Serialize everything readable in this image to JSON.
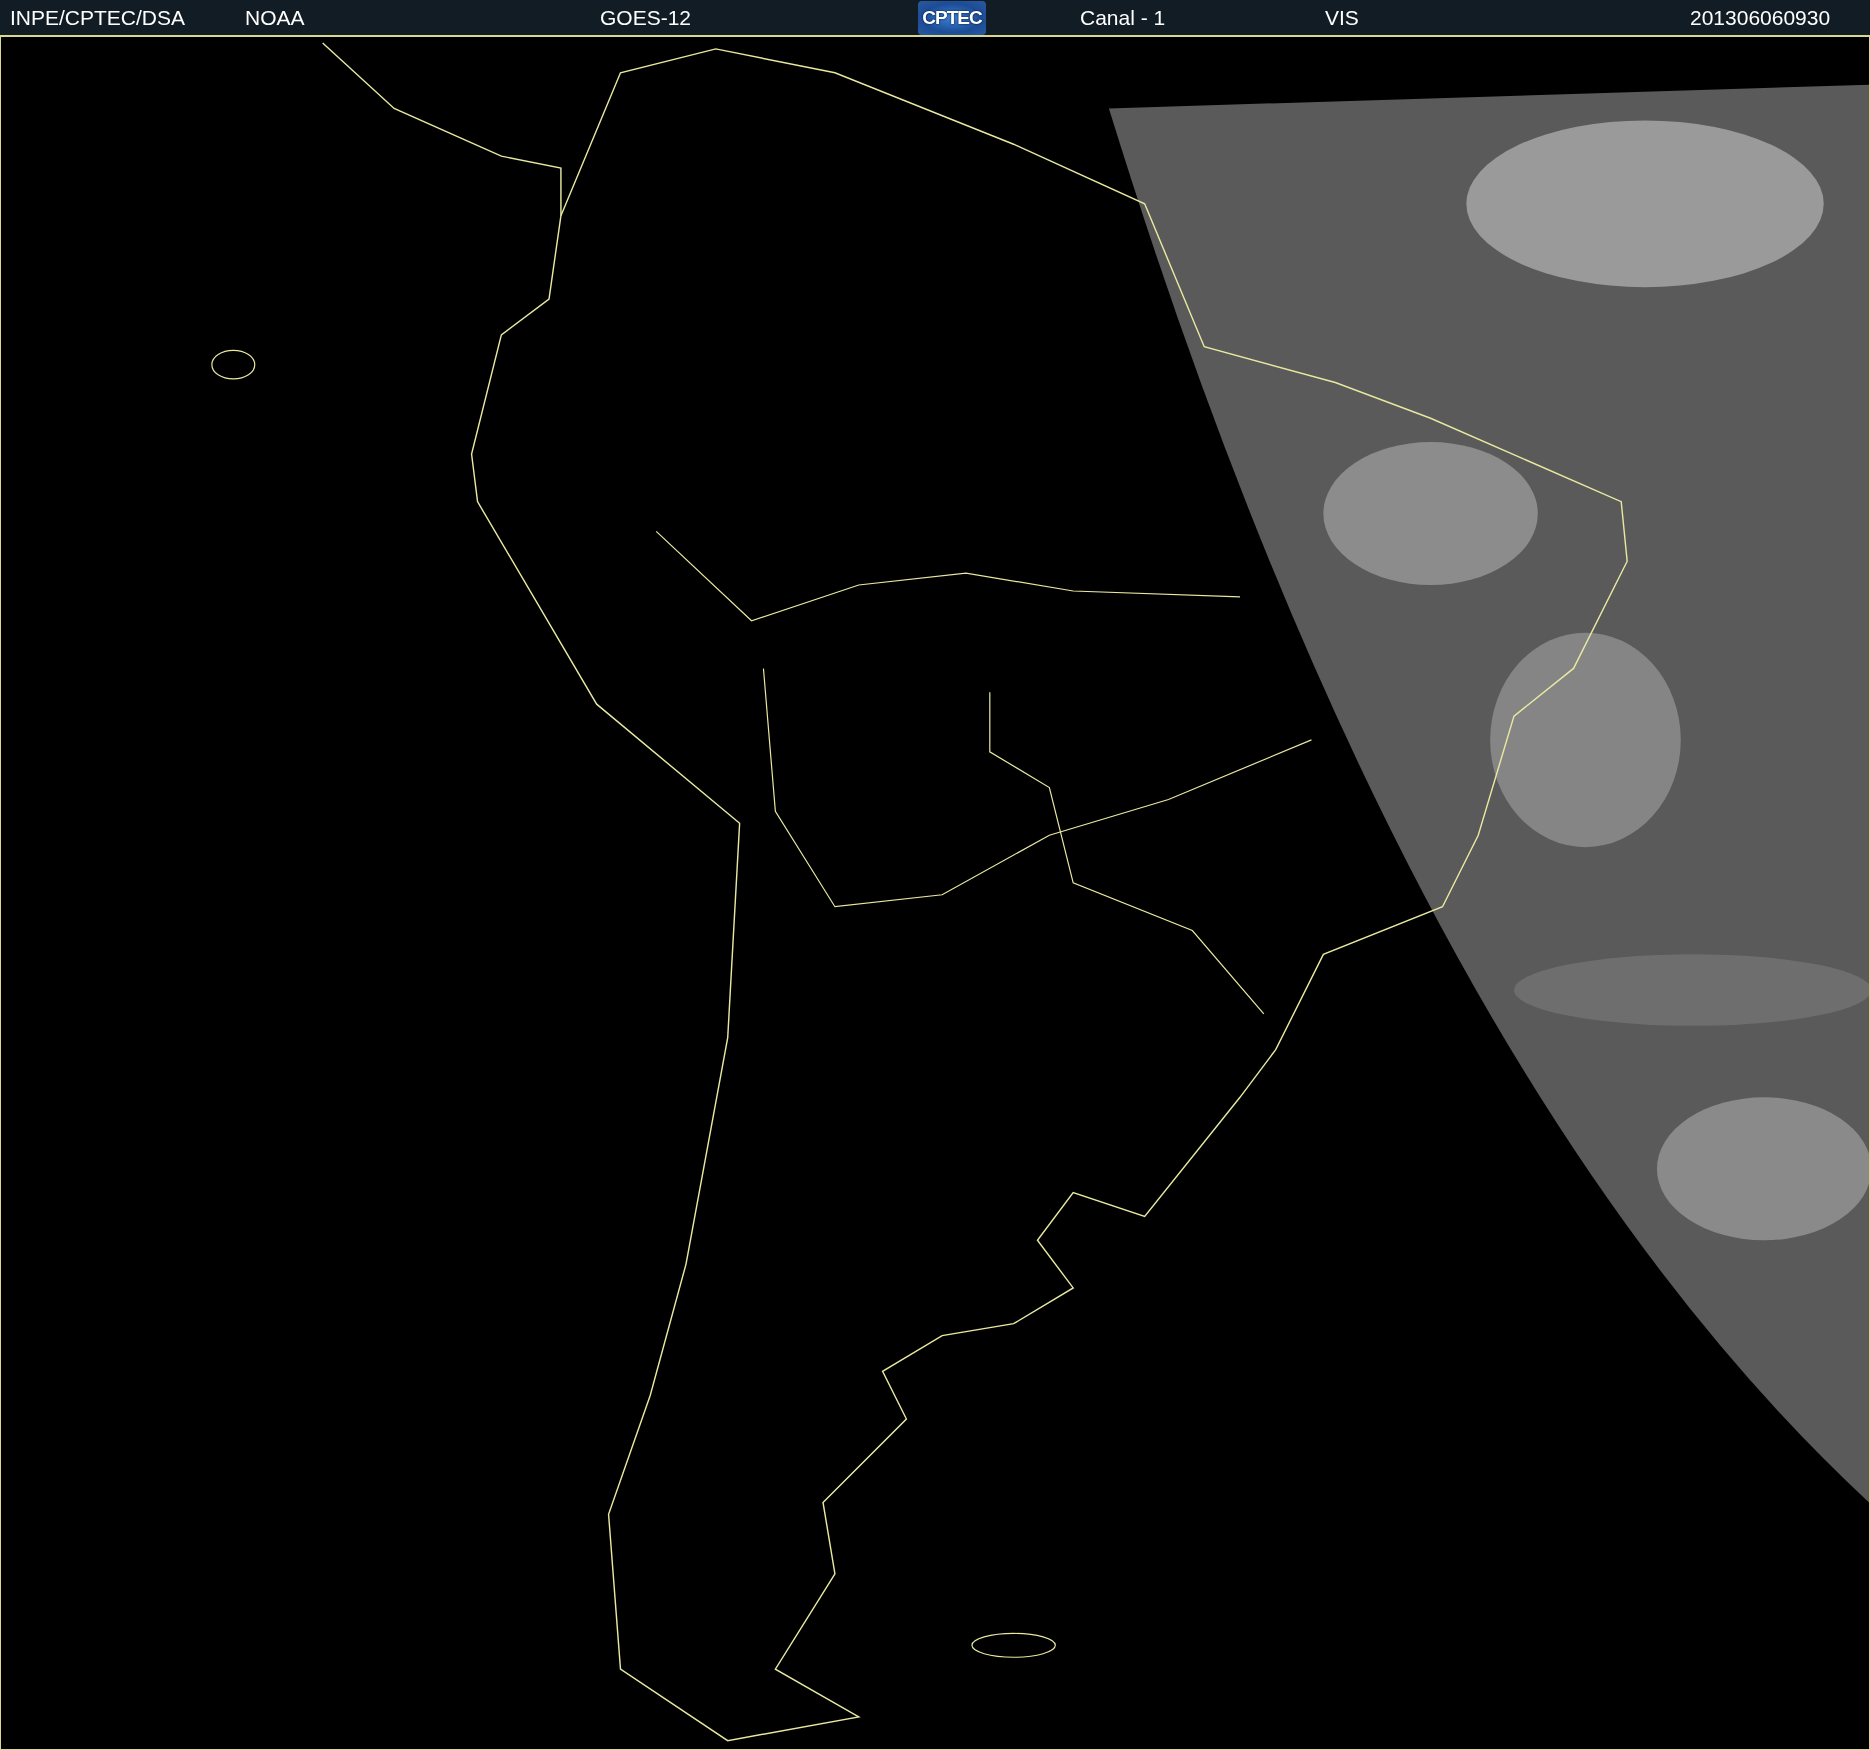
{
  "header": {
    "items": [
      {
        "kind": "text",
        "text": "INPE/CPTEC/DSA"
      },
      {
        "kind": "text",
        "text": "NOAA"
      },
      {
        "kind": "text",
        "text": "GOES-12"
      },
      {
        "kind": "logo",
        "text": "CPTEC"
      },
      {
        "kind": "text",
        "text": "Canal - 1"
      },
      {
        "kind": "text",
        "text": "VIS"
      },
      {
        "kind": "text",
        "text": "201306060930"
      }
    ]
  }
}
